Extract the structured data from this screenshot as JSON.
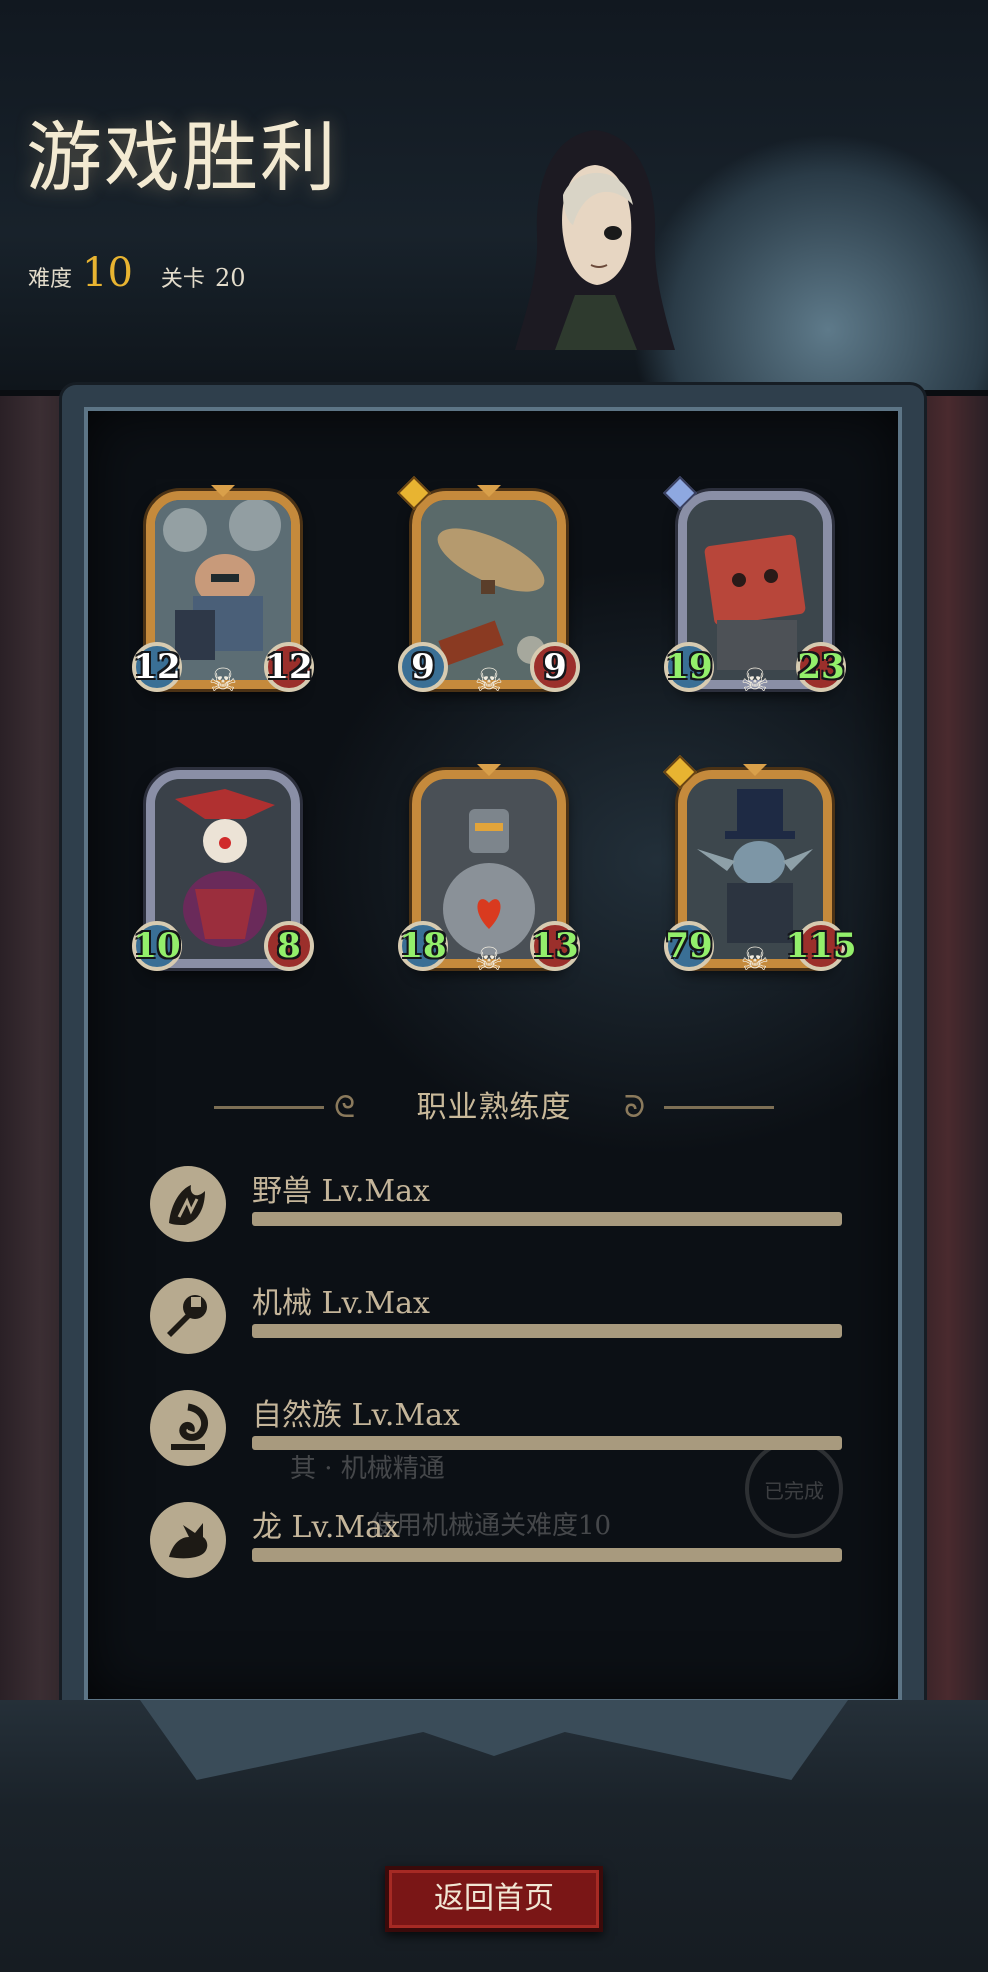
{
  "header": {
    "title": "游戏胜利",
    "difficulty_label": "难度",
    "difficulty_value": "10",
    "level_label": "关卡",
    "level_value": "20"
  },
  "cards": [
    {
      "name": "card-mechanic",
      "attack": "12",
      "health": "12",
      "frame": "gold"
    },
    {
      "name": "card-airship",
      "attack": "9",
      "health": "9",
      "frame": "gold"
    },
    {
      "name": "card-red-golem",
      "attack": "19",
      "health": "23",
      "frame": "silver"
    },
    {
      "name": "card-clown",
      "attack": "10",
      "health": "8",
      "frame": "silver"
    },
    {
      "name": "card-iron-robot",
      "attack": "18",
      "health": "13",
      "frame": "gold"
    },
    {
      "name": "card-top-hat-goblin",
      "attack": "79",
      "health": "115",
      "frame": "gold"
    }
  ],
  "mastery": {
    "title": "职业熟练度",
    "items": [
      {
        "label": "野兽 Lv.Max",
        "progress": 1.0,
        "icon": "beast-icon"
      },
      {
        "label": "机械 Lv.Max",
        "progress": 1.0,
        "icon": "mechanic-icon"
      },
      {
        "label": "自然族 Lv.Max",
        "progress": 1.0,
        "icon": "nature-icon"
      },
      {
        "label": "龙 Lv.Max",
        "progress": 1.0,
        "icon": "dragon-icon"
      }
    ]
  },
  "background_text": {
    "line1": "其 · 机械精通",
    "line2": "使用机械通关难度10",
    "badge": "已完成"
  },
  "footer": {
    "home_button": "返回首页"
  },
  "colors": {
    "accent_gold": "#e8b431",
    "button_red": "#7a1616"
  }
}
